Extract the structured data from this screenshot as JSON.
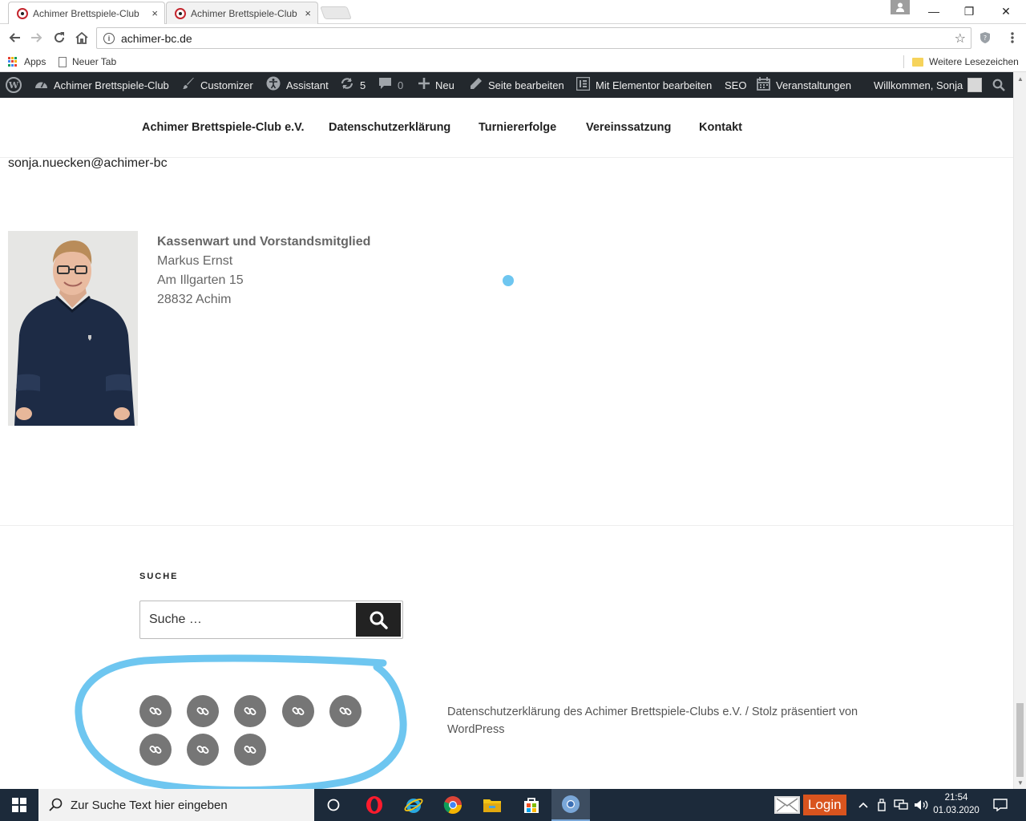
{
  "browser": {
    "tabs": [
      {
        "title": "Achimer Brettspiele-Club",
        "close": "×",
        "active": true
      },
      {
        "title": "Achimer Brettspiele-Club",
        "close": "×",
        "active": false
      }
    ],
    "window_controls": {
      "minimize": "—",
      "maximize": "❐",
      "close": "✕"
    },
    "url": "achimer-bc.de",
    "bookmarks": {
      "apps": "Apps",
      "new_tab": "Neuer Tab",
      "other": "Weitere Lesezeichen"
    }
  },
  "adminbar": {
    "site": "Achimer Brettspiele-Club",
    "customizer": "Customizer",
    "assistant": "Assistant",
    "updates_count": "5",
    "comments_count": "0",
    "new": "Neu",
    "edit_page": "Seite bearbeiten",
    "elementor": "Mit Elementor bearbeiten",
    "seo": "SEO",
    "events": "Veranstaltungen",
    "welcome": "Willkommen, Sonja"
  },
  "site_nav": {
    "items": [
      "Achimer Brettspiele-Club e.V.",
      "Datenschutzerklärung",
      "Turniererfolge",
      "Vereinssatzung",
      "Kontakt"
    ]
  },
  "content": {
    "email": "sonja.nuecken@achimer-bc",
    "member": {
      "role": "Kassenwart und Vorstandsmitglied",
      "name": "Markus Ernst",
      "street": "Am Illgarten 15",
      "city": "28832 Achim"
    }
  },
  "footer": {
    "search_title": "SUCHE",
    "search_placeholder": "Suche …",
    "social_link_count": 8,
    "site_info_link": "Datenschutzerklärung des Achimer Brettspiele-Clubs e.V.",
    "separator": "/",
    "powered_by": "Stolz präsentiert von WordPress"
  },
  "taskbar": {
    "search_placeholder": "Zur Suche Text hier eingeben",
    "login_label": "Login",
    "time": "21:54",
    "date": "01.03.2020"
  },
  "colors": {
    "adminbar_bg": "#23282d",
    "social_icon_bg": "#767676",
    "annotation_blue": "#6ec6f0",
    "taskbar_bg": "#1c2a3a"
  }
}
